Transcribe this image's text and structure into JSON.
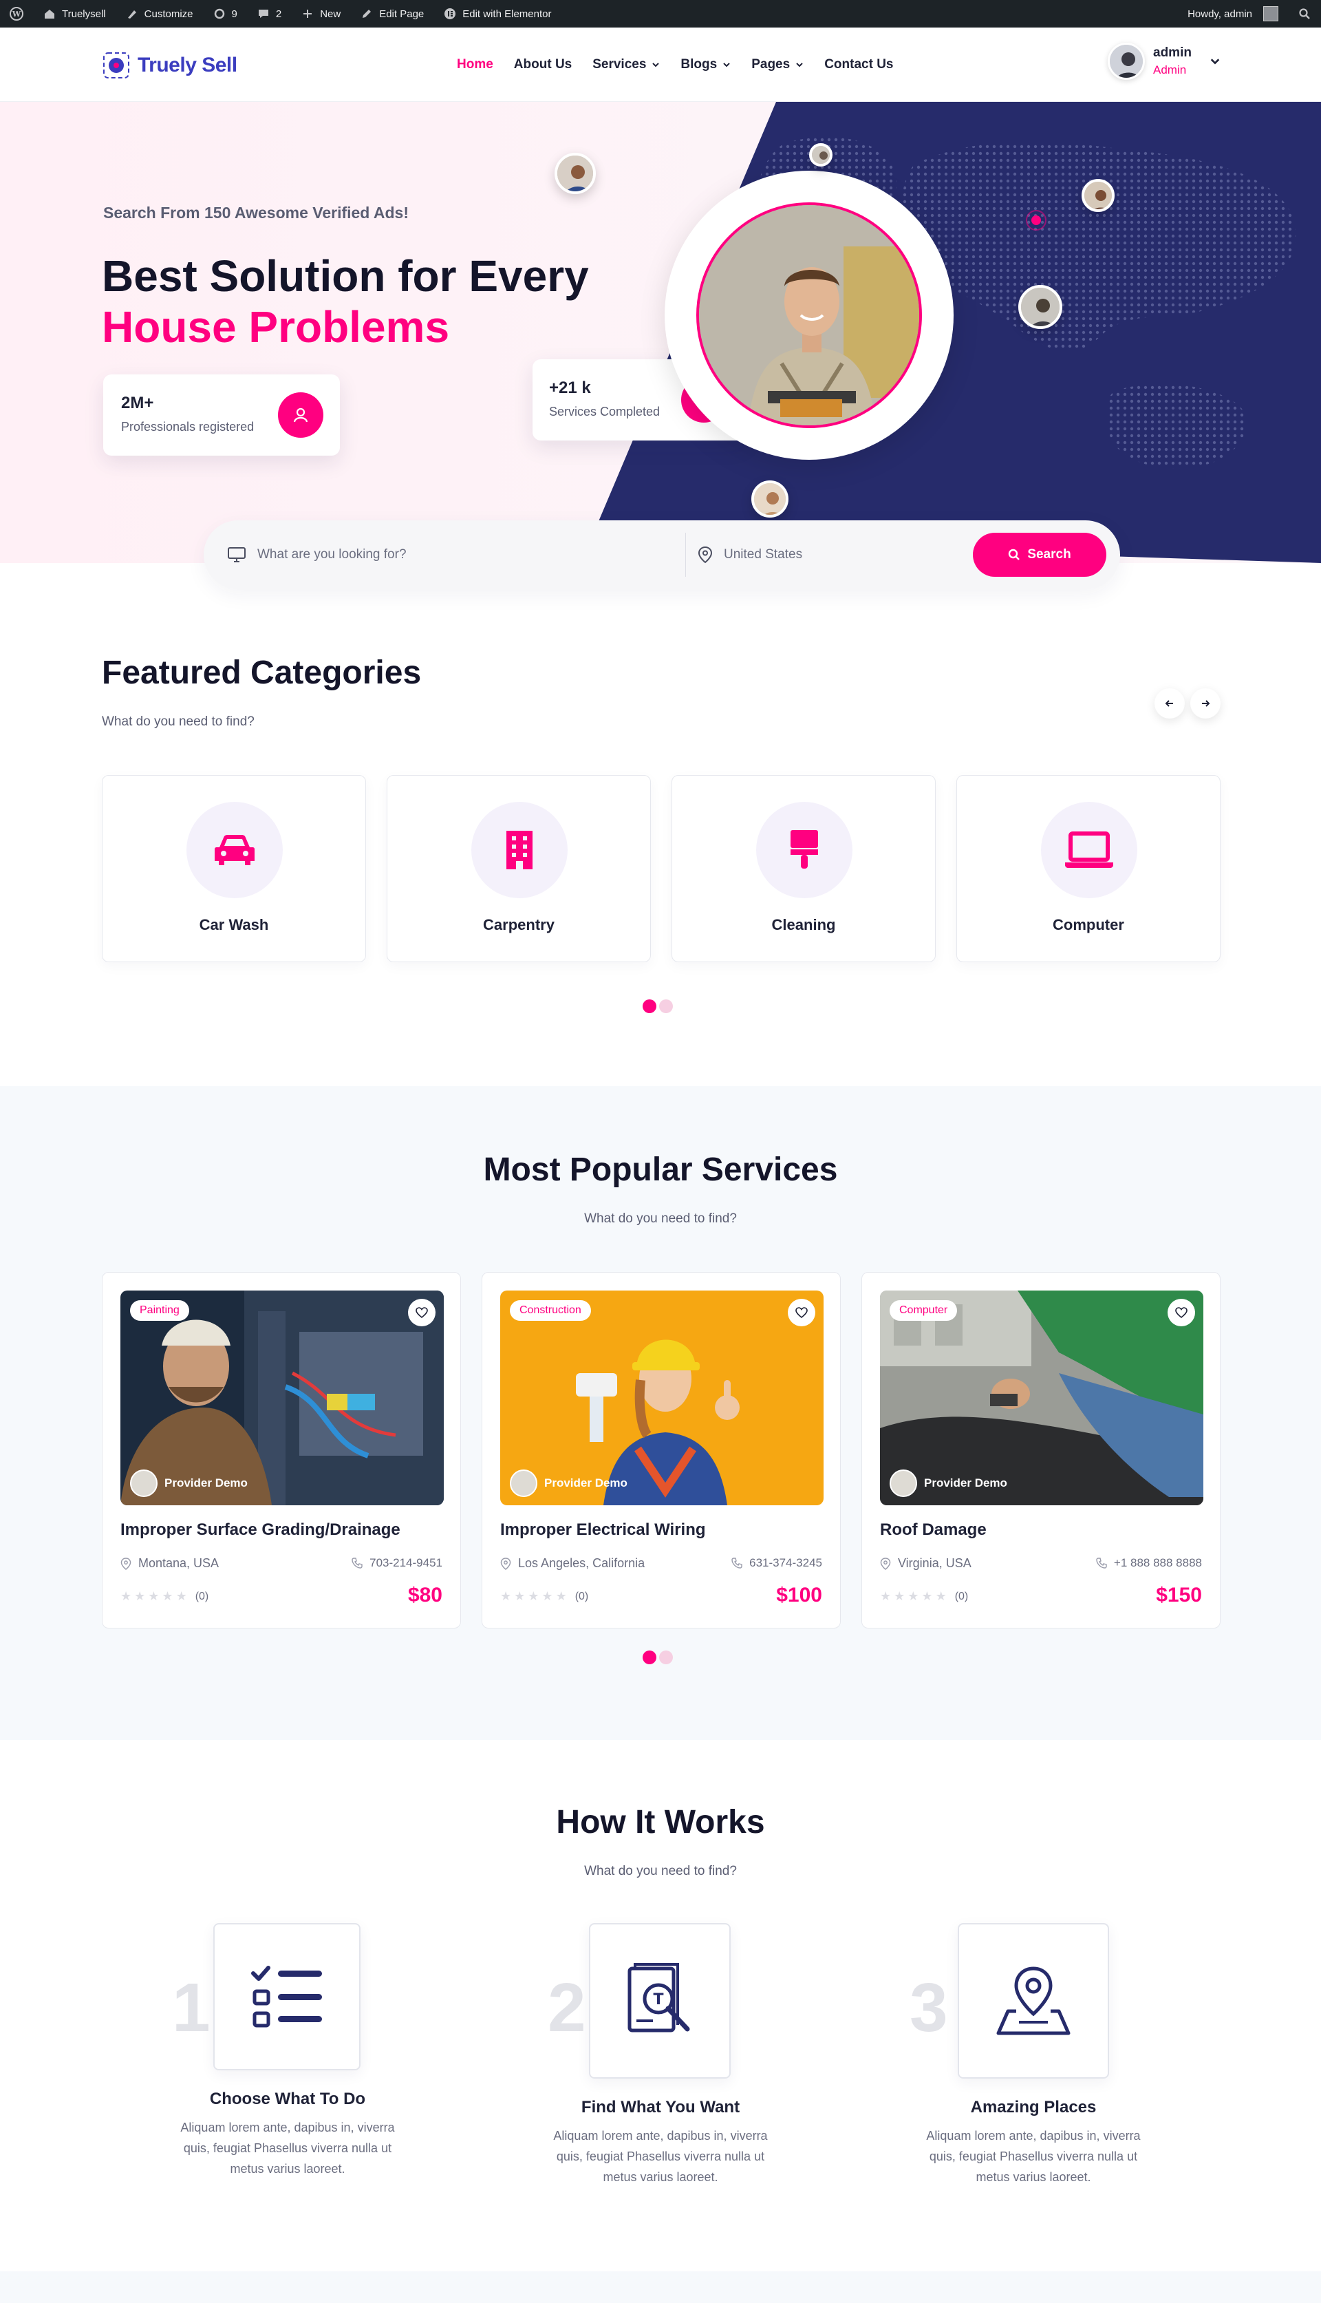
{
  "adminbar": {
    "site": "Truelysell",
    "customize": "Customize",
    "updates": "9",
    "comments": "2",
    "new": "New",
    "edit_page": "Edit Page",
    "edit_elementor": "Edit with Elementor",
    "howdy": "Howdy, admin"
  },
  "header": {
    "logo": "Truely Sell",
    "nav": [
      "Home",
      "About Us",
      "Services",
      "Blogs",
      "Pages",
      "Contact Us"
    ],
    "user_name": "admin",
    "user_role": "Admin"
  },
  "hero": {
    "eyebrow": "Search From 150 Awesome Verified Ads!",
    "title_line1": "Best Solution for Every",
    "title_line2": "House Problems",
    "stat1_value": "2M+",
    "stat1_label": "Professionals registered",
    "stat2_value": "+21 k",
    "stat2_label": "Services Completed"
  },
  "search": {
    "keyword_placeholder": "What are you looking for?",
    "location_placeholder": "United States",
    "button": "Search"
  },
  "featured": {
    "title": "Featured Categories",
    "subtitle": "What do you need to find?",
    "categories": [
      "Car Wash",
      "Carpentry",
      "Cleaning",
      "Computer"
    ]
  },
  "popular": {
    "title": "Most Popular Services",
    "subtitle": "What do you need to find?",
    "services": [
      {
        "tag": "Painting",
        "provider": "Provider Demo",
        "title": "Improper Surface Grading/Drainage",
        "location": "Montana, USA",
        "phone": "703-214-9451",
        "reviews": "(0)",
        "price": "$80"
      },
      {
        "tag": "Construction",
        "provider": "Provider Demo",
        "title": "Improper Electrical Wiring",
        "location": "Los Angeles, California",
        "phone": "631-374-3245",
        "reviews": "(0)",
        "price": "$100"
      },
      {
        "tag": "Computer",
        "provider": "Provider Demo",
        "title": "Roof Damage",
        "location": "Virginia, USA",
        "phone": "+1 888 888 8888",
        "reviews": "(0)",
        "price": "$150"
      }
    ]
  },
  "how": {
    "title": "How It Works",
    "subtitle": "What do you need to find?",
    "steps": [
      {
        "num": "1",
        "title": "Choose What To Do",
        "text": [
          "Aliquam lorem ante, dapibus in, viverra",
          "quis, feugiat Phasellus viverra nulla ut",
          "metus varius laoreet."
        ]
      },
      {
        "num": "2",
        "title": "Find What You Want",
        "text": [
          "Aliquam lorem ante, dapibus in, viverra",
          "quis, feugiat Phasellus viverra nulla ut",
          "metus varius laoreet."
        ]
      },
      {
        "num": "3",
        "title": "Amazing Places",
        "text": [
          "Aliquam lorem ante, dapibus in, viverra",
          "quis, feugiat Phasellus viverra nulla ut",
          "metus varius laoreet."
        ]
      }
    ]
  },
  "colors": {
    "accent": "#ff0080",
    "navy": "#262b6b",
    "brand": "#3b3dbf"
  }
}
